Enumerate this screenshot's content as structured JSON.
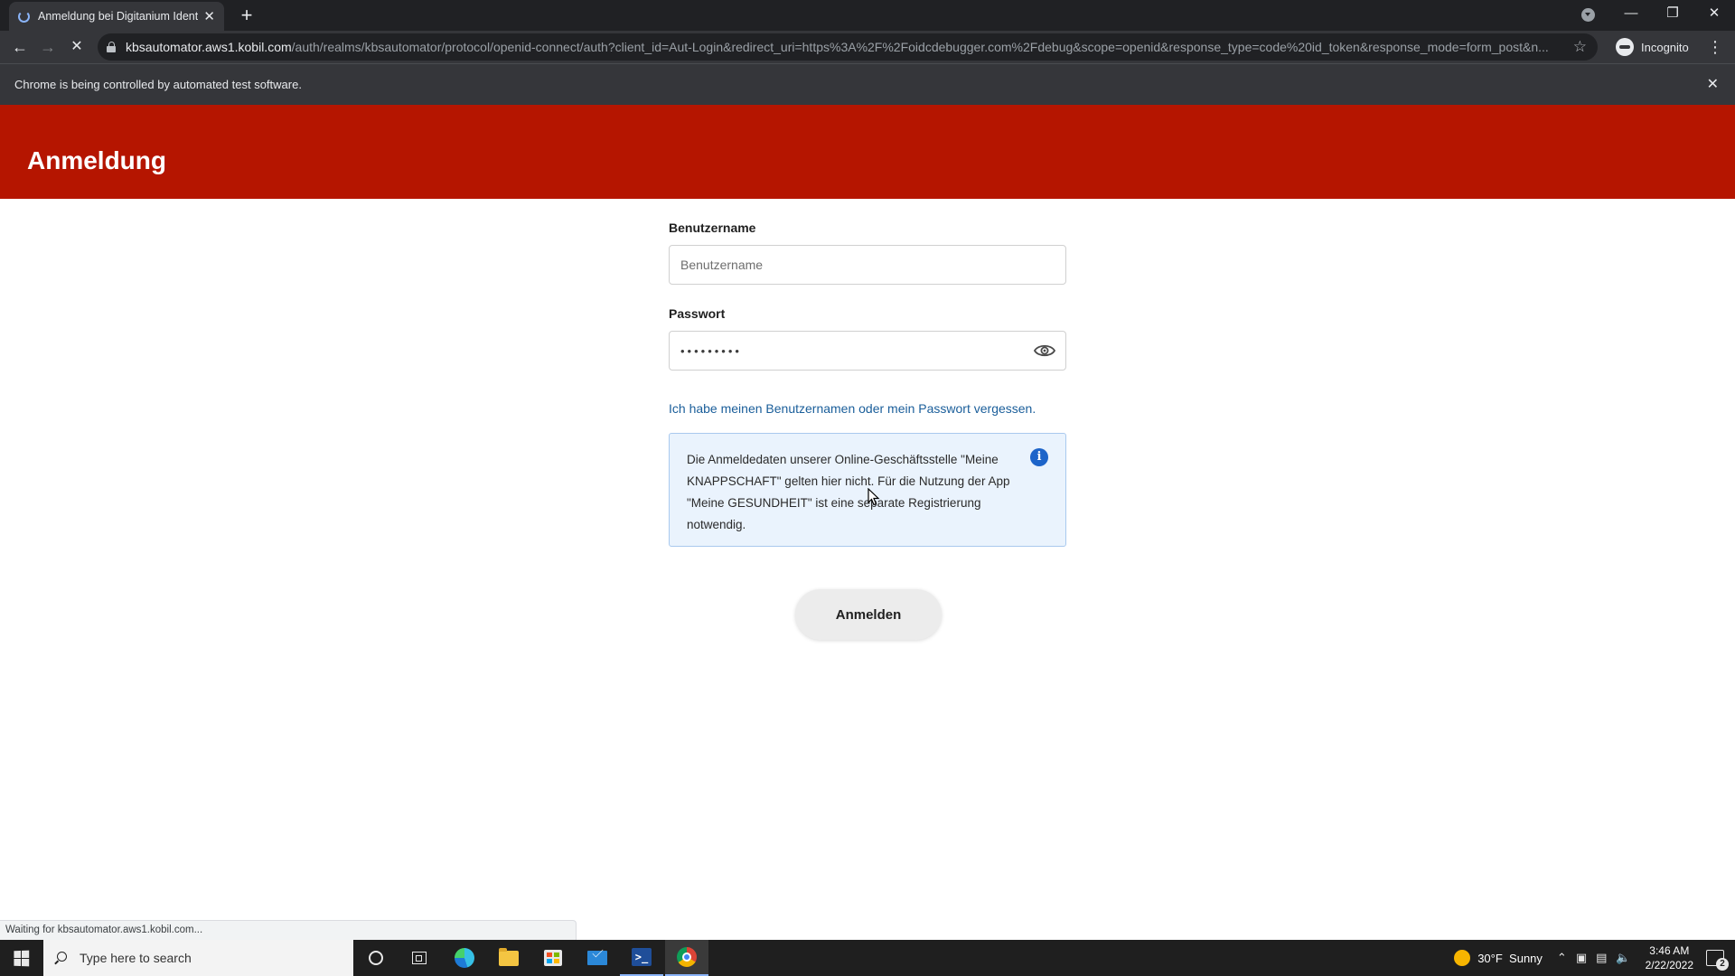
{
  "browser": {
    "tab_title": "Anmeldung bei Digitanium Ident",
    "url_host": "kbsautomator.aws1.kobil.com",
    "url_path": "/auth/realms/kbsautomator/protocol/openid-connect/auth?client_id=Aut-Login&redirect_uri=https%3A%2F%2Foidcdebugger.com%2Fdebug&scope=openid&response_type=code%20id_token&response_mode=form_post&n...",
    "profile_label": "Incognito",
    "infobar_text": "Chrome is being controlled by automated test software.",
    "status_text": "Waiting for kbsautomator.aws1.kobil.com..."
  },
  "page": {
    "title": "Anmeldung",
    "header_color": "#b51500",
    "username": {
      "label": "Benutzername",
      "placeholder": "Benutzername",
      "value": ""
    },
    "password": {
      "label": "Passwort",
      "masked_value": "•••••••••"
    },
    "forgot_link": "Ich habe meinen Benutzernamen oder mein Passwort vergessen.",
    "info_text": "Die Anmeldedaten unserer Online-Geschäftsstelle \"Meine KNAPPSCHAFT\" gelten hier nicht. Für die Nutzung der App \"Meine GESUNDHEIT\" ist eine separate Registrierung notwendig.",
    "info_icon": "i",
    "submit_label": "Anmelden"
  },
  "taskbar": {
    "search_placeholder": "Type here to search",
    "weather_temp": "30°F",
    "weather_text": "Sunny",
    "time": "3:46 AM",
    "date": "2/22/2022",
    "notification_count": "2"
  },
  "icons": {
    "back": "←",
    "forward": "→",
    "reload_stop": "✕",
    "star": "☆",
    "menu": "⋮",
    "new_tab": "+",
    "tab_close": "✕",
    "minimize": "—",
    "restore": "❐",
    "close": "✕"
  }
}
